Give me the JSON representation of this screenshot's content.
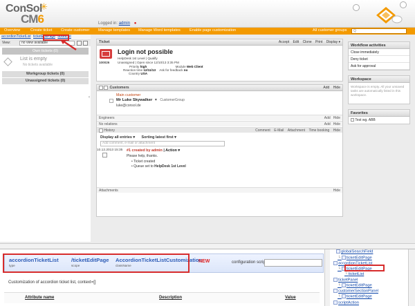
{
  "header": {
    "logo_top": "ConSol",
    "logo_bottom_prefix": "CM",
    "logo_bottom_suffix": "6",
    "logged_in_label": "Logged in:",
    "logged_in_user": "admin"
  },
  "nav": {
    "items": [
      "Overview",
      "Create ticket",
      "Create customer",
      "Manage templates",
      "Manage Word templates",
      "Enable page customization"
    ],
    "groups": "All customer groups",
    "search_placeholder": "Q"
  },
  "left": {
    "tabs": [
      "accordionTicketList",
      "ticketEditPage",
      "ticketList"
    ],
    "view_label": "View:",
    "view_value": "no view available",
    "own_tickets": "Own tickets (0)",
    "empty_title": "List is empty",
    "empty_sub": "No tickets available",
    "workgroup": "Workgroup tickets (0)",
    "unassigned": "Unassigned tickets (0)"
  },
  "ticket": {
    "header": "Ticket",
    "actions": [
      "Accept",
      "Edit",
      "Clone",
      "Print",
      "Display ▾"
    ],
    "number": "100026",
    "title": "Login not possible",
    "line1": "HelpDesk 1st Level | Qualify",
    "line2": "Unassigned | Open since 12/10/13 3:35 PM",
    "priority_label": "Priority",
    "priority": "high",
    "module_label": "Module",
    "module": "Web Client",
    "reaction_label": "Reaction time",
    "reaction": "12/11/13",
    "feedback_label": "Ask for feedback",
    "feedback": "no",
    "country_label": "Country",
    "country": "USA"
  },
  "customers": {
    "header": "Customers",
    "actions": [
      "Add",
      "Hide"
    ],
    "main_label": "Main customer",
    "name": "Mr Luke Skywalker",
    "group": "CustomerGroup",
    "email": "luke@consol.de"
  },
  "engineers": {
    "header": "Engineers",
    "actions": [
      "Add",
      "Hide"
    ]
  },
  "relations": {
    "header": "No relations",
    "actions": [
      "Add",
      "Hide"
    ]
  },
  "history": {
    "header": "History",
    "actions": [
      "Comment",
      "E-Mail",
      "Attachment",
      "Time booking",
      "Hide"
    ],
    "display": "Display all entries",
    "sort": "Sorting latest first",
    "add_placeholder": "Add comment, e-mail or attachment",
    "entry_time": "10.12.2013 15:35",
    "entry_title": "#1 created by admin",
    "entry_action": "Action",
    "entry_text": "Please help, thanks.",
    "bullet1": "Ticket created",
    "bullet2_prefix": "Queue set to",
    "bullet2_value": "HelpDesk 1st Level"
  },
  "attachments": {
    "header": "Attachments",
    "actions": [
      "Hide"
    ]
  },
  "workflow": {
    "header": "Workflow activities",
    "items": [
      "Close immediately",
      "Deny ticket",
      "Ask for approval"
    ]
  },
  "workspace": {
    "header": "Workspace",
    "text": "Workspace is empty. All your unsaved tasks are automatically listed in this workspace."
  },
  "favorites": {
    "header": "Favorites",
    "item": "Test wg. ABB"
  },
  "bottom": {
    "type_value": "accordionTicketList",
    "type_label": "type",
    "scope_value": "/ticketEditPage",
    "scope_label": "scope",
    "class_value": "AccordionTicketListCustomization",
    "class_label": "className",
    "new_tag": "NEW",
    "cfg_label": "configuration script:",
    "custom_text": "Customization of accordion ticket list, context=[]",
    "col_attr": "Attribute name",
    "col_desc": "Description",
    "col_value": "Value"
  },
  "tree": {
    "items": [
      "globalSearchField",
      "ticketEditPage",
      "accordionTicketList",
      "ticketEditPage",
      "ticketList",
      "ticketPanel",
      "ticketEditPage",
      "customerSectionPanel",
      "ticketEditPage",
      "scriptAction"
    ]
  },
  "colors": {
    "accent": "#f39a00",
    "link": "#0a43a8",
    "highlight": "#d72b2b"
  }
}
